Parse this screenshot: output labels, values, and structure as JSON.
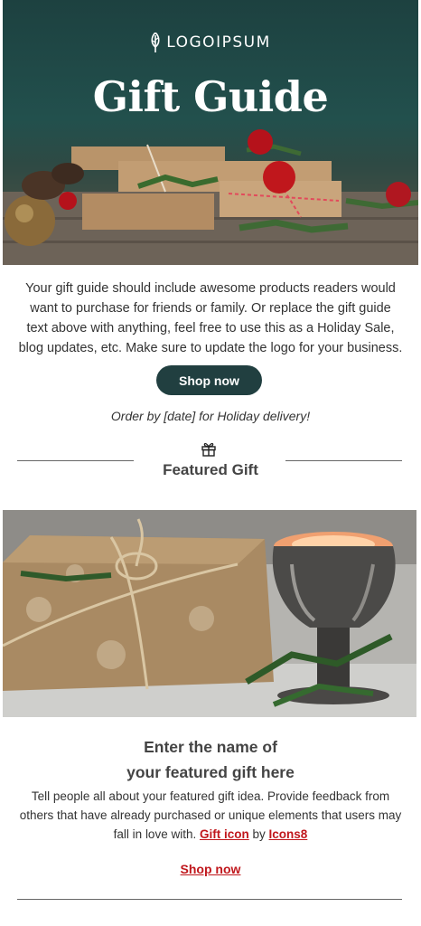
{
  "hero": {
    "logo_text": "LOGOIPSUM",
    "title": "Gift Guide"
  },
  "intro": {
    "text": "Your gift guide should include awesome products readers would want to purchase for friends or family. Or replace the gift guide text above with anything, feel free to use this as a Holiday Sale, blog updates, etc. Make sure to update the logo for your business.",
    "button_label": "Shop now",
    "order_note": "Order by [date] for Holiday delivery!"
  },
  "featured": {
    "section_title": "Featured Gift",
    "title_line1": "Enter the name of",
    "title_line2": "your featured gift here",
    "description": "Tell people all about your featured gift idea. Provide feedback from others that have already purchased or unique elements that users may fall in love with.",
    "credit_link_1": "Gift icon",
    "credit_by": "by",
    "credit_link_2": "Icons8",
    "shop_link": "Shop now"
  },
  "colors": {
    "button_bg": "#213f40",
    "link_red": "#c0171c",
    "hero_bg": "#1d4140"
  },
  "icons": {
    "logo": "leaf-logo-icon",
    "section": "gift-icon"
  }
}
